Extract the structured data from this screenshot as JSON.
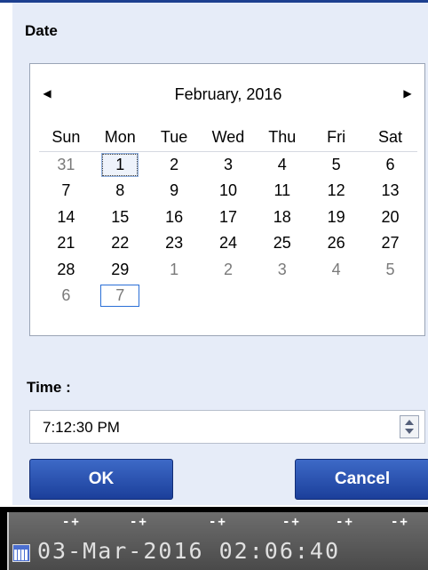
{
  "date_section": {
    "label": "Date"
  },
  "calendar": {
    "month_title": "February, 2016",
    "prev_icon": "triangle-left",
    "next_icon": "triangle-right",
    "weekdays": [
      "Sun",
      "Mon",
      "Tue",
      "Wed",
      "Thu",
      "Fri",
      "Sat"
    ],
    "weeks": [
      [
        {
          "d": "31",
          "other": true
        },
        {
          "d": "1",
          "sel": true
        },
        {
          "d": "2"
        },
        {
          "d": "3"
        },
        {
          "d": "4"
        },
        {
          "d": "5"
        },
        {
          "d": "6"
        }
      ],
      [
        {
          "d": "7"
        },
        {
          "d": "8"
        },
        {
          "d": "9"
        },
        {
          "d": "10"
        },
        {
          "d": "11"
        },
        {
          "d": "12"
        },
        {
          "d": "13"
        }
      ],
      [
        {
          "d": "14"
        },
        {
          "d": "15"
        },
        {
          "d": "16"
        },
        {
          "d": "17"
        },
        {
          "d": "18"
        },
        {
          "d": "19"
        },
        {
          "d": "20"
        }
      ],
      [
        {
          "d": "21"
        },
        {
          "d": "22"
        },
        {
          "d": "23"
        },
        {
          "d": "24"
        },
        {
          "d": "25"
        },
        {
          "d": "26"
        },
        {
          "d": "27"
        }
      ],
      [
        {
          "d": "28"
        },
        {
          "d": "29"
        },
        {
          "d": "1",
          "other": true
        },
        {
          "d": "2",
          "other": true
        },
        {
          "d": "3",
          "other": true
        },
        {
          "d": "4",
          "other": true
        },
        {
          "d": "5",
          "other": true
        }
      ],
      [
        {
          "d": "6",
          "other": true
        },
        {
          "d": "7",
          "other": true,
          "today": true
        }
      ]
    ]
  },
  "time_section": {
    "label": "Time :",
    "value": "7:12:30 PM"
  },
  "buttons": {
    "ok": "OK",
    "cancel": "Cancel"
  },
  "taskbar": {
    "steppers": [
      "-+",
      "-+",
      "-+",
      "-+",
      "-+",
      "-+"
    ],
    "datetime": "03-Mar-2016 02:06:40"
  },
  "colors": {
    "button": "#1f47a8",
    "dialog_bg": "#e6ecf8",
    "taskbar": "#555555"
  }
}
